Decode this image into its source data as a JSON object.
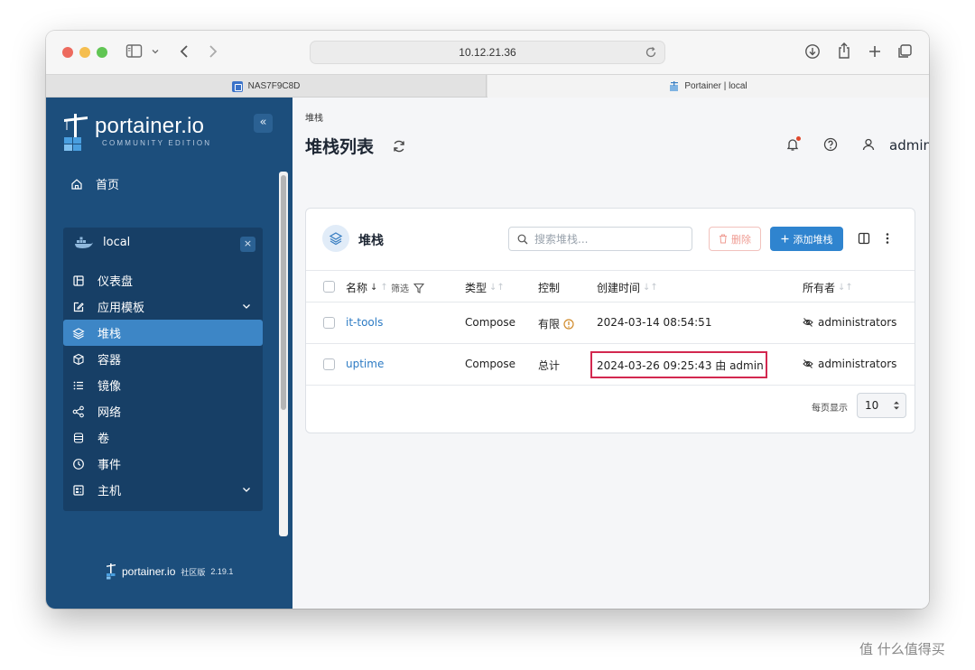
{
  "browser": {
    "url": "10.12.21.36",
    "tabs": [
      {
        "label": "NAS7F9C8D",
        "icon": "nas-app-icon"
      },
      {
        "label": "Portainer | local",
        "icon": "portainer-favicon"
      }
    ],
    "icons": [
      "sidebar-toggle-icon",
      "chevron-down-icon",
      "back-icon",
      "forward-icon",
      "reload-icon",
      "download-icon",
      "share-icon",
      "new-tab-icon",
      "tab-overview-icon"
    ]
  },
  "sidebar": {
    "logo_text": "portainer.io",
    "logo_sub": "COMMUNITY EDITION",
    "collapse": "«",
    "home": "首页",
    "environment": {
      "name": "local",
      "close": "×",
      "items": [
        {
          "label": "仪表盘",
          "icon": "dashboard-icon"
        },
        {
          "label": "应用模板",
          "icon": "edit-icon",
          "expandable": true
        },
        {
          "label": "堆栈",
          "icon": "layers-icon",
          "active": true
        },
        {
          "label": "容器",
          "icon": "box-icon"
        },
        {
          "label": "镜像",
          "icon": "list-icon"
        },
        {
          "label": "网络",
          "icon": "share-nodes-icon"
        },
        {
          "label": "卷",
          "icon": "database-icon"
        },
        {
          "label": "事件",
          "icon": "clock-icon"
        },
        {
          "label": "主机",
          "icon": "server-icon",
          "expandable": true
        }
      ]
    },
    "footer": {
      "brand": "portainer.io",
      "edition": "社区版",
      "version": "2.19.1"
    }
  },
  "header": {
    "breadcrumb": "堆栈",
    "title": "堆栈列表",
    "user": "admin"
  },
  "panel": {
    "title": "堆栈",
    "search_placeholder": "搜索堆栈...",
    "delete_label": "删除",
    "add_label": "添加堆栈",
    "columns": {
      "name": "名称",
      "filter": "筛选",
      "type": "类型",
      "control": "控制",
      "created": "创建时间",
      "owner": "所有者"
    },
    "rows": [
      {
        "name": "it-tools",
        "type": "Compose",
        "control": "有限",
        "control_warning": true,
        "created": "2024-03-14 08:54:51",
        "owner": "administrators",
        "highlight": false
      },
      {
        "name": "uptime",
        "type": "Compose",
        "control": "总计",
        "control_warning": false,
        "created": "2024-03-26 09:25:43 由 admin",
        "owner": "administrators",
        "highlight": true
      }
    ],
    "pager": {
      "label": "每页显示",
      "value": "10"
    }
  },
  "colors": {
    "sidebar_bg": "#1c4e7c",
    "sidebar_active": "#3d86c6",
    "primary": "#2f84cf",
    "link": "#2d7bc4",
    "highlight": "#d3284f"
  },
  "watermark": "值 什么值得买"
}
